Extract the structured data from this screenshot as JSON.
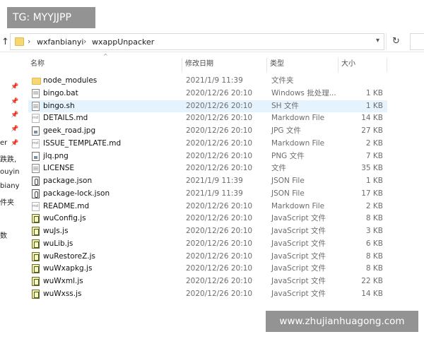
{
  "watermarks": {
    "top_left": "TG: MYYJJPP",
    "bottom_right": "www.zhujianhuagong.com"
  },
  "address_bar": {
    "crumbs": [
      "wxfanbianyi",
      "wxappUnpacker"
    ],
    "separator": "›",
    "icons": [
      "up-arrow-icon",
      "folder-icon",
      "chevron-down-icon",
      "refresh-icon"
    ]
  },
  "nav_fragments": [
    "",
    "er",
    "跌跌,",
    "ouyin",
    "biany",
    "件夹",
    "数"
  ],
  "columns": {
    "name": "名称",
    "date": "修改日期",
    "type": "类型",
    "size": "大小"
  },
  "files": [
    {
      "name": "node_modules",
      "date": "2021/1/9 11:39",
      "type": "文件夹",
      "size": "",
      "icon": "folder"
    },
    {
      "name": "bingo.bat",
      "date": "2020/12/26 20:10",
      "type": "Windows 批处理...",
      "size": "1 KB",
      "icon": "bat"
    },
    {
      "name": "bingo.sh",
      "date": "2020/12/26 20:10",
      "type": "SH 文件",
      "size": "1 KB",
      "icon": "doc",
      "selected": true
    },
    {
      "name": "DETAILS.md",
      "date": "2020/12/26 20:10",
      "type": "Markdown File",
      "size": "14 KB",
      "icon": "md"
    },
    {
      "name": "geek_road.jpg",
      "date": "2020/12/26 20:10",
      "type": "JPG 文件",
      "size": "27 KB",
      "icon": "img"
    },
    {
      "name": "ISSUE_TEMPLATE.md",
      "date": "2020/12/26 20:10",
      "type": "Markdown File",
      "size": "2 KB",
      "icon": "md"
    },
    {
      "name": "jlq.png",
      "date": "2020/12/26 20:10",
      "type": "PNG 文件",
      "size": "7 KB",
      "icon": "img"
    },
    {
      "name": "LICENSE",
      "date": "2020/12/26 20:10",
      "type": "文件",
      "size": "35 KB",
      "icon": "doc"
    },
    {
      "name": "package.json",
      "date": "2021/1/9 11:39",
      "type": "JSON File",
      "size": "1 KB",
      "icon": "json"
    },
    {
      "name": "package-lock.json",
      "date": "2021/1/9 11:39",
      "type": "JSON File",
      "size": "17 KB",
      "icon": "json"
    },
    {
      "name": "README.md",
      "date": "2020/12/26 20:10",
      "type": "Markdown File",
      "size": "2 KB",
      "icon": "md"
    },
    {
      "name": "wuConfig.js",
      "date": "2020/12/26 20:10",
      "type": "JavaScript 文件",
      "size": "8 KB",
      "icon": "js"
    },
    {
      "name": "wuJs.js",
      "date": "2020/12/26 20:10",
      "type": "JavaScript 文件",
      "size": "3 KB",
      "icon": "js"
    },
    {
      "name": "wuLib.js",
      "date": "2020/12/26 20:10",
      "type": "JavaScript 文件",
      "size": "6 KB",
      "icon": "js"
    },
    {
      "name": "wuRestoreZ.js",
      "date": "2020/12/26 20:10",
      "type": "JavaScript 文件",
      "size": "8 KB",
      "icon": "js"
    },
    {
      "name": "wuWxapkg.js",
      "date": "2020/12/26 20:10",
      "type": "JavaScript 文件",
      "size": "8 KB",
      "icon": "js"
    },
    {
      "name": "wuWxml.js",
      "date": "2020/12/26 20:10",
      "type": "JavaScript 文件",
      "size": "22 KB",
      "icon": "js"
    },
    {
      "name": "wuWxss.js",
      "date": "2020/12/26 20:10",
      "type": "JavaScript 文件",
      "size": "14 KB",
      "icon": "js"
    }
  ],
  "colors": {
    "selected_row": "#e5f3ff",
    "folder": "#f7d774",
    "meta_text": "#6d6d6d"
  }
}
